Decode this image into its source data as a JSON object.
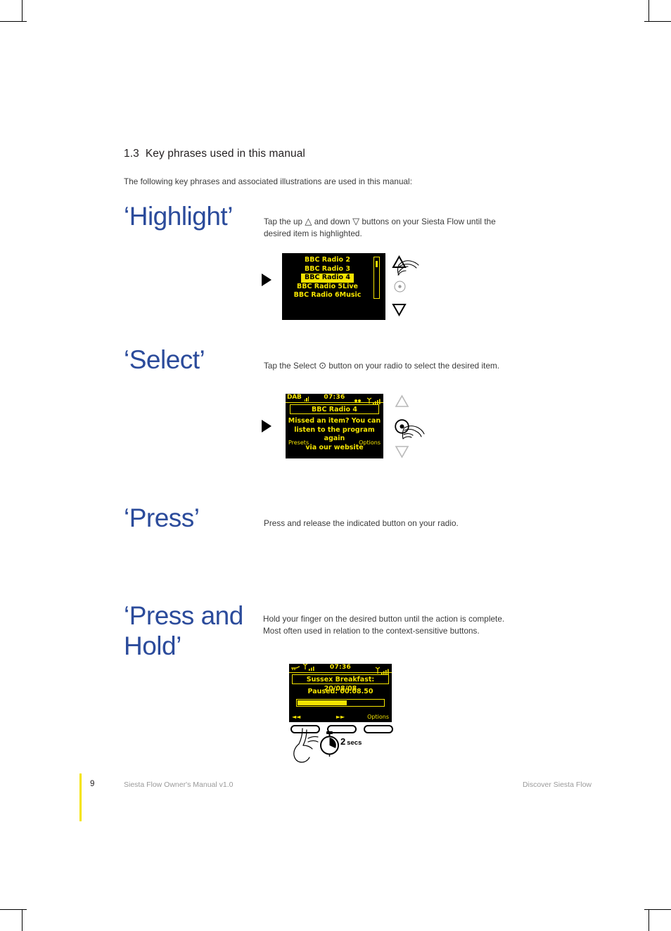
{
  "section": {
    "number": "1.3",
    "title": "Key phrases used in this manual",
    "intro": "The following key phrases and associated illustrations are used in this manual:"
  },
  "phrases": [
    {
      "title": "‘Highlight’",
      "desc_line1_a": "Tap the up ",
      "desc_up_glyph": "△",
      "desc_line1_b": " and down ",
      "desc_down_glyph": "▽",
      "desc_line1_c": " buttons on your Siesta Flow until the",
      "desc_line2": "desired item is highlighted."
    },
    {
      "title": "‘Select’",
      "desc_a": "Tap the Select ",
      "desc_glyph": "⊙",
      "desc_b": " button on your radio to select the desired item."
    },
    {
      "title": "‘Press’",
      "desc": "Press and release the indicated button on your radio."
    },
    {
      "title": "‘Press and\nHold’",
      "desc_line1": "Hold your finger on the desired button until the action is complete.",
      "desc_line2": "Most often used in relation to the context-sensitive buttons."
    }
  ],
  "screen_highlight": {
    "items": [
      "BBC Radio 2",
      "BBC Radio 3",
      "BBC Radio 4",
      "BBC Radio 5Live",
      "BBC Radio 6Music"
    ],
    "selected_index": 2,
    "scroll_position_pct": 8
  },
  "screen_select": {
    "status_source": "DAB",
    "status_time": "07:36",
    "title": "BBC Radio 4",
    "body_line1": "Missed an item? You can",
    "body_line2": "listen to the program again",
    "body_line3": "via our website",
    "softkey_left": "Presets",
    "softkey_right": "Options"
  },
  "screen_presshold": {
    "status_time": "07:36",
    "title": "Sussex Breakfast: 20/08/08",
    "status_text": "Paused: 00:08.50",
    "progress_pct": 58,
    "softkey_left": "◄◄",
    "softkey_mid": "►►",
    "softkey_right": "Options",
    "hold_duration_label_num": "2",
    "hold_duration_label_unit": "secs"
  },
  "footer": {
    "page_number": "9",
    "left": "Siesta Flow Owner's Manual v1.0",
    "right": "Discover Siesta Flow"
  },
  "colors": {
    "heading_blue": "#2b4b9b",
    "lcd_yellow": "#f5e400",
    "lcd_black": "#000000",
    "accent_rule": "#f5e400"
  }
}
